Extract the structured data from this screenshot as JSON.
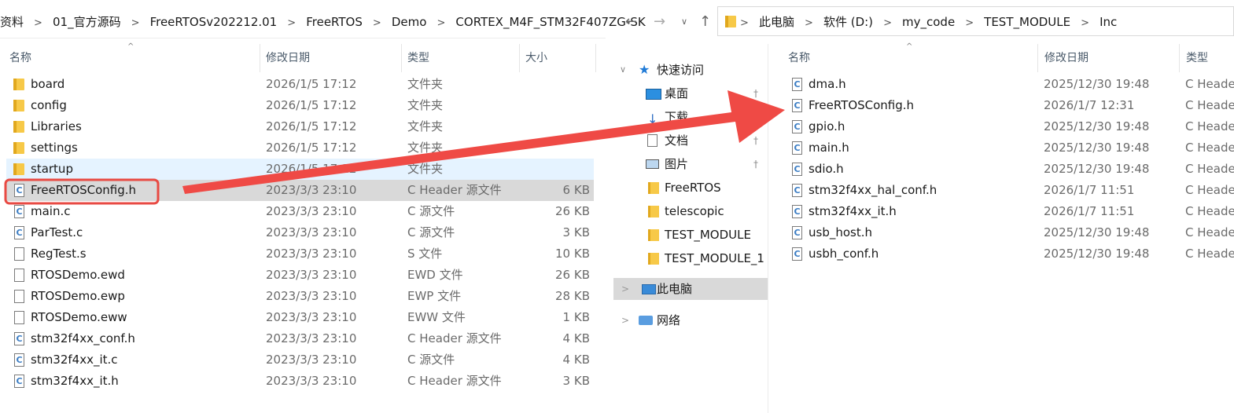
{
  "left": {
    "breadcrumb": [
      "资料",
      "01_官方源码",
      "FreeRTOSv202212.01",
      "FreeRTOS",
      "Demo",
      "CORTEX_M4F_STM32F407ZG-SK"
    ],
    "headers": {
      "name": "名称",
      "date": "修改日期",
      "type": "类型",
      "size": "大小"
    },
    "rows": [
      {
        "name": "board",
        "date": "2026/1/5 17:12",
        "type": "文件夹",
        "size": "",
        "icon": "folder-icon"
      },
      {
        "name": "config",
        "date": "2026/1/5 17:12",
        "type": "文件夹",
        "size": "",
        "icon": "folder-icon"
      },
      {
        "name": "Libraries",
        "date": "2026/1/5 17:12",
        "type": "文件夹",
        "size": "",
        "icon": "folder-icon"
      },
      {
        "name": "settings",
        "date": "2026/1/5 17:12",
        "type": "文件夹",
        "size": "",
        "icon": "folder-icon"
      },
      {
        "name": "startup",
        "date": "2026/1/5 17:12",
        "type": "文件夹",
        "size": "",
        "icon": "folder-icon"
      },
      {
        "name": "FreeRTOSConfig.h",
        "date": "2023/3/3 23:10",
        "type": "C Header 源文件",
        "size": "6 KB",
        "icon": "c-header-file-icon"
      },
      {
        "name": "main.c",
        "date": "2023/3/3 23:10",
        "type": "C 源文件",
        "size": "26 KB",
        "icon": "c-source-file-icon"
      },
      {
        "name": "ParTest.c",
        "date": "2023/3/3 23:10",
        "type": "C 源文件",
        "size": "3 KB",
        "icon": "c-source-file-icon"
      },
      {
        "name": "RegTest.s",
        "date": "2023/3/3 23:10",
        "type": "S 文件",
        "size": "10 KB",
        "icon": "file-icon"
      },
      {
        "name": "RTOSDemo.ewd",
        "date": "2023/3/3 23:10",
        "type": "EWD 文件",
        "size": "26 KB",
        "icon": "file-icon"
      },
      {
        "name": "RTOSDemo.ewp",
        "date": "2023/3/3 23:10",
        "type": "EWP 文件",
        "size": "28 KB",
        "icon": "file-icon"
      },
      {
        "name": "RTOSDemo.eww",
        "date": "2023/3/3 23:10",
        "type": "EWW 文件",
        "size": "1 KB",
        "icon": "file-icon"
      },
      {
        "name": "stm32f4xx_conf.h",
        "date": "2023/3/3 23:10",
        "type": "C Header 源文件",
        "size": "4 KB",
        "icon": "c-header-file-icon"
      },
      {
        "name": "stm32f4xx_it.c",
        "date": "2023/3/3 23:10",
        "type": "C 源文件",
        "size": "4 KB",
        "icon": "c-source-file-icon"
      },
      {
        "name": "stm32f4xx_it.h",
        "date": "2023/3/3 23:10",
        "type": "C Header 源文件",
        "size": "3 KB",
        "icon": "c-header-file-icon"
      }
    ]
  },
  "right": {
    "breadcrumb": [
      "此电脑",
      "软件 (D:)",
      "my_code",
      "TEST_MODULE",
      "Inc"
    ],
    "headers": {
      "name": "名称",
      "date": "修改日期",
      "type": "类型"
    },
    "nav": {
      "quick_access": "快速访问",
      "items": [
        {
          "label": "桌面",
          "pinned": true,
          "icon": "desktop-icon"
        },
        {
          "label": "下载",
          "pinned": true,
          "icon": "download-icon"
        },
        {
          "label": "文档",
          "pinned": true,
          "icon": "document-icon"
        },
        {
          "label": "图片",
          "pinned": true,
          "icon": "picture-icon"
        },
        {
          "label": "FreeRTOS",
          "pinned": false,
          "icon": "folder-icon"
        },
        {
          "label": "telescopic",
          "pinned": false,
          "icon": "folder-icon"
        },
        {
          "label": "TEST_MODULE",
          "pinned": false,
          "icon": "folder-icon"
        },
        {
          "label": "TEST_MODULE_1",
          "pinned": false,
          "icon": "folder-icon"
        }
      ],
      "this_pc": "此电脑",
      "network": "网络"
    },
    "rows": [
      {
        "name": "dma.h",
        "date": "2025/12/30 19:48",
        "type": "C Heade"
      },
      {
        "name": "FreeRTOSConfig.h",
        "date": "2026/1/7 12:31",
        "type": "C Heade"
      },
      {
        "name": "gpio.h",
        "date": "2025/12/30 19:48",
        "type": "C Heade"
      },
      {
        "name": "main.h",
        "date": "2025/12/30 19:48",
        "type": "C Heade"
      },
      {
        "name": "sdio.h",
        "date": "2025/12/30 19:48",
        "type": "C Heade"
      },
      {
        "name": "stm32f4xx_hal_conf.h",
        "date": "2026/1/7 11:51",
        "type": "C Heade"
      },
      {
        "name": "stm32f4xx_it.h",
        "date": "2026/1/7 11:51",
        "type": "C Heade"
      },
      {
        "name": "usb_host.h",
        "date": "2025/12/30 19:48",
        "type": "C Heade"
      },
      {
        "name": "usbh_conf.h",
        "date": "2025/12/30 19:48",
        "type": "C Heade"
      }
    ]
  },
  "colors": {
    "hover_row": "#e5f3ff",
    "selected_row": "#d9d9d9",
    "highlight_box": "#e84a43",
    "arrow": "#ef4a45"
  }
}
